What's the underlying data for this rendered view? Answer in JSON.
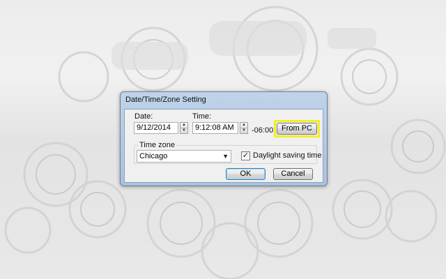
{
  "dialog": {
    "title": "Date/Time/Zone Setting",
    "date_label": "Date:",
    "date_value": "9/12/2014",
    "time_label": "Time:",
    "time_value": "9:12:08 AM",
    "utc_offset": "-06:00",
    "from_pc_label": "From PC",
    "timezone_group_label": "Time zone",
    "timezone_value": "Chicago",
    "daylight_saving_label": "Daylight saving time",
    "daylight_saving_checked": true,
    "checkbox_glyph": "✓",
    "spin_up_glyph": "▲",
    "spin_down_glyph": "▼",
    "dropdown_arrow_glyph": "▼",
    "ok_label": "OK",
    "cancel_label": "Cancel"
  },
  "colors": {
    "highlight_frame": "#f2ee27",
    "title_bar": "#bfd3ea"
  },
  "icons": {
    "background": "camera-lens-collage",
    "spinner_up": "triangle-up-icon",
    "spinner_down": "triangle-down-icon",
    "dropdown": "chevron-down-icon",
    "checkbox": "checkmark-icon"
  }
}
